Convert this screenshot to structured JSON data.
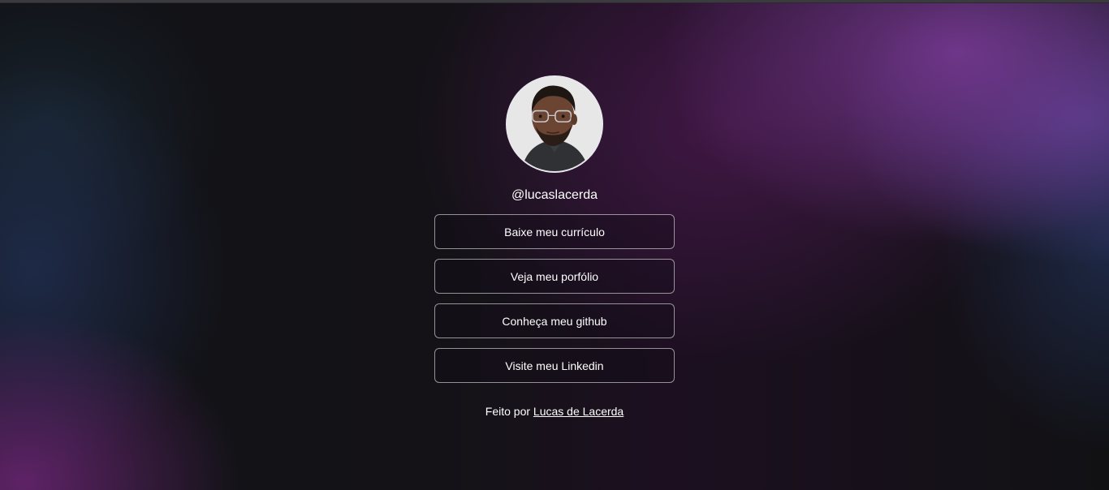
{
  "profile": {
    "username": "@lucaslacerda",
    "avatar_icon": "profile-photo"
  },
  "links": [
    {
      "label": "Baixe meu currículo"
    },
    {
      "label": "Veja meu porfólio"
    },
    {
      "label": "Conheça meu github"
    },
    {
      "label": "Visite meu Linkedin"
    }
  ],
  "footer": {
    "prefix": "Feito por",
    "author_link": "Lucas de Lacerda"
  },
  "colors": {
    "text": "#ffffff",
    "background": "#111114",
    "accent_purple": "#7a3a96",
    "accent_blue": "#2c3c6e"
  }
}
